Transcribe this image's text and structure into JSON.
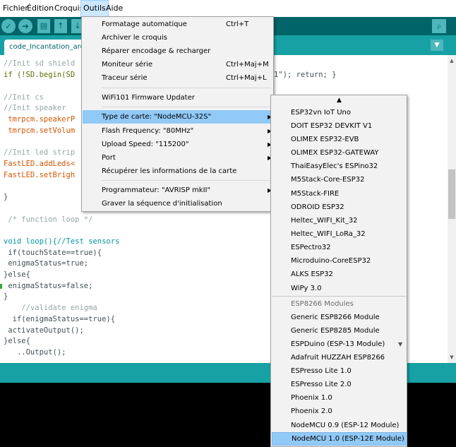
{
  "menubar": {
    "items": [
      "Fichier",
      "Édition",
      "Croquis",
      "Outils",
      "Aide"
    ]
  },
  "toolbar": {
    "verify_icon": "check-icon",
    "upload_icon": "arrow-right-icon",
    "new_icon": "file-icon",
    "open_icon": "arrow-up-icon",
    "save_icon": "arrow-down-icon",
    "serial_icon": "magnifier-icon"
  },
  "tab": {
    "label": "code_Incantation_ard",
    "menu_icon": "triangle-down-icon"
  },
  "editor": {
    "lines": [
      "//Init sd shield",
      "if (!SD.begin(SD",
      "",
      "//Init cs",
      "//Init speaker",
      " tmrpcm.speakerP",
      " tmrpcm.setVolum",
      "",
      "//Init led strip",
      "FastLED.addLeds<",
      "FastLED.setBrigh",
      "",
      "}",
      "",
      " /* function loop */",
      "",
      "void loop(){//Test sensors",
      " if(touchState==true){",
      " enigmaStatus=true;",
      "}else{",
      " enigmaStatus=false;",
      "}",
      "    //validate enigma",
      "  if(enigmaStatus==true){",
      " activateOutput();",
      "}else{",
      "   ..Output();"
    ],
    "line1_suffix": "1\"); return; }"
  },
  "outils_menu": {
    "items": [
      {
        "label": "Formatage automatique",
        "shortcut": "Ctrl+T"
      },
      {
        "label": "Archiver le croquis",
        "shortcut": ""
      },
      {
        "label": "Réparer encodage & recharger",
        "shortcut": ""
      },
      {
        "label": "Moniteur série",
        "shortcut": "Ctrl+Maj+M"
      },
      {
        "label": "Traceur série",
        "shortcut": "Ctrl+Maj+L"
      },
      {
        "label": "WiFi101 Firmware Updater",
        "shortcut": ""
      },
      {
        "label": "Type de carte: \"NodeMCU-32S\"",
        "shortcut": ""
      },
      {
        "label": "Flash Frequency: \"80MHz\"",
        "shortcut": ""
      },
      {
        "label": "Upload Speed: \"115200\"",
        "shortcut": ""
      },
      {
        "label": "Port",
        "shortcut": ""
      },
      {
        "label": "Récupérer les informations de la carte",
        "shortcut": ""
      },
      {
        "label": "Programmateur: \"AVRISP mkII\"",
        "shortcut": ""
      },
      {
        "label": "Graver la séquence d'initialisation",
        "shortcut": ""
      }
    ],
    "submenu_arrow": "▶"
  },
  "board_submenu": {
    "scroll_up": "▲",
    "scroll_down": "▼",
    "items": [
      "ESP32vn IoT Uno",
      "DOIT ESP32 DEVKIT V1",
      "OLIMEX ESP32-EVB",
      "OLIMEX ESP32-GATEWAY",
      "ThaiEasyElec's ESPino32",
      "M5Stack-Core-ESP32",
      "M5Stack-FIRE",
      "ODROID ESP32",
      "Heltec_WIFI_Kit_32",
      "Heltec_WIFI_LoRa_32",
      "ESPectro32",
      "Microduino-CoreESP32",
      "ALKS ESP32",
      "WiPy 3.0"
    ],
    "section_header": "ESP8266 Modules",
    "items2": [
      "Generic ESP8266 Module",
      "Generic ESP8285 Module",
      "ESPDuino (ESP-13 Module)",
      "Adafruit HUZZAH ESP8266",
      "ESPresso Lite 1.0",
      "ESPresso Lite 2.0",
      "Phoenix 1.0",
      "Phoenix 2.0",
      "NodeMCU 0.9 (ESP-12 Module)",
      "NodeMCU 1.0 (ESP-12E Module)"
    ]
  },
  "colors": {
    "toolbar": "#006468",
    "tabbar": "#17a1a5",
    "highlight": "#91c9f7",
    "keyword": "#00979c",
    "constant": "#d35400",
    "comment": "#95a5a6"
  }
}
